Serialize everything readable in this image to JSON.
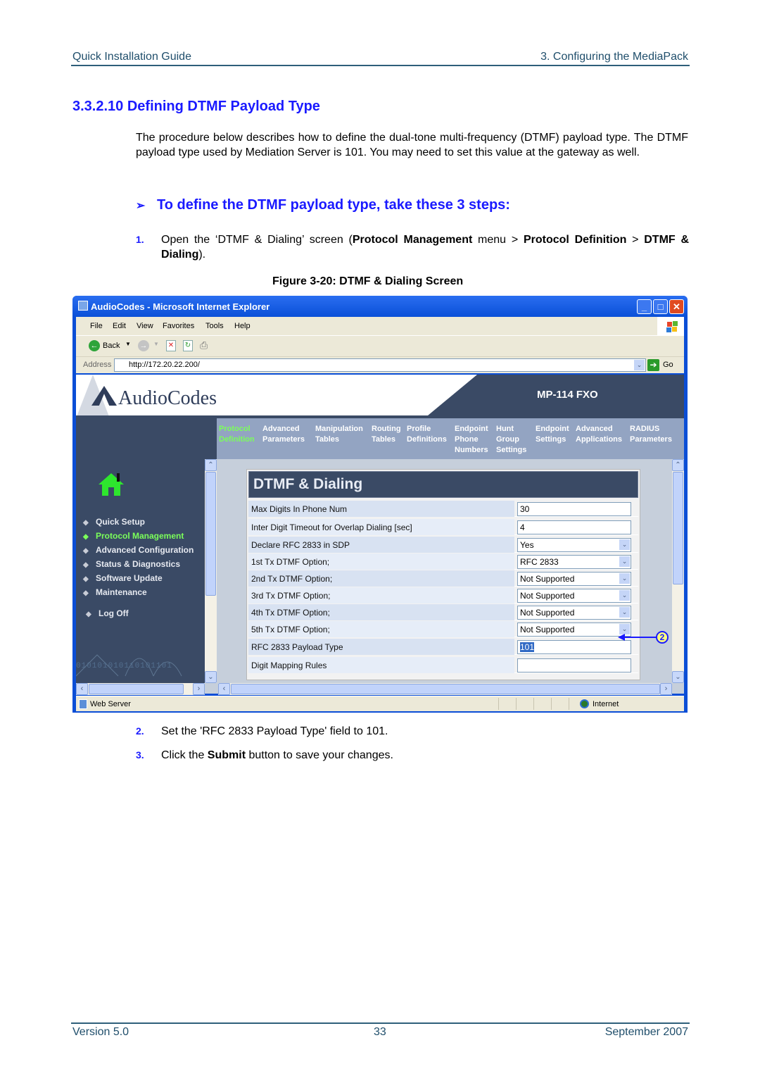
{
  "header": {
    "left": "Quick Installation Guide",
    "right": "3. Configuring the MediaPack"
  },
  "section_title": "3.3.2.10 Defining DTMF Payload Type",
  "intro": "The procedure below describes how to define the dual-tone multi-frequency (DTMF) payload type. The DTMF payload type used by Mediation Server is 101. You may need to set this value at the gateway as well.",
  "procedure_heading": "To define the DTMF payload type, take these 3 steps:",
  "procedure_arrow": "➢",
  "steps": [
    {
      "num": "1.",
      "parts": [
        "Open the ‘DTMF & Dialing’ screen (",
        "Protocol Management",
        " menu > ",
        "Protocol Definition",
        " > ",
        "DTMF & Dialing",
        ")."
      ]
    },
    {
      "num": "2.",
      "text": "Set the 'RFC 2833 Payload Type' field to 101."
    },
    {
      "num": "3.",
      "parts": [
        "Click the ",
        "Submit",
        " button to save your changes."
      ]
    }
  ],
  "figure_caption": "Figure 3-20: DTMF & Dialing Screen",
  "browser": {
    "title": "AudioCodes - Microsoft Internet Explorer",
    "menu": [
      "File",
      "Edit",
      "View",
      "Favorites",
      "Tools",
      "Help"
    ],
    "back_label": "Back",
    "address_label": "Address",
    "address": "http://172.20.22.200/",
    "go_label": "Go",
    "status_left": "Web Server",
    "status_right": "Internet"
  },
  "app": {
    "brand": "AudioCodes",
    "model": "MP-114 FXO",
    "nav": [
      {
        "line1": "Protocol",
        "line2": "Definition",
        "line3": "",
        "active": true
      },
      {
        "line1": "Advanced",
        "line2": "Parameters",
        "line3": ""
      },
      {
        "line1": "Manipulation",
        "line2": "Tables",
        "line3": ""
      },
      {
        "line1": "Routing",
        "line2": "Tables",
        "line3": ""
      },
      {
        "line1": "Profile",
        "line2": "Definitions",
        "line3": ""
      },
      {
        "line1": "Endpoint",
        "line2": "Phone",
        "line3": "Numbers"
      },
      {
        "line1": "Hunt",
        "line2": "Group",
        "line3": "Settings"
      },
      {
        "line1": "Endpoint",
        "line2": "Settings",
        "line3": ""
      },
      {
        "line1": "Advanced",
        "line2": "Applications",
        "line3": ""
      },
      {
        "line1": "RADIUS",
        "line2": "Parameters",
        "line3": ""
      }
    ],
    "sidebar": [
      {
        "label": "Quick Setup"
      },
      {
        "label": "Protocol Management",
        "active": true
      },
      {
        "label": "Advanced Configuration"
      },
      {
        "label": "Status & Diagnostics"
      },
      {
        "label": "Software Update"
      },
      {
        "label": "Maintenance"
      }
    ],
    "logoff": "Log Off",
    "binary_deco": "010101010110101101",
    "panel_title": "DTMF & Dialing",
    "fields": [
      {
        "label": "Max Digits In Phone Num",
        "value": "30",
        "type": "text"
      },
      {
        "label": "Inter Digit Timeout for Overlap Dialing [sec]",
        "value": "4",
        "type": "text"
      },
      {
        "label": "Declare RFC 2833 in SDP",
        "value": "Yes",
        "type": "select"
      },
      {
        "label": "1st Tx DTMF Option;",
        "value": "RFC 2833",
        "type": "select"
      },
      {
        "label": "2nd Tx DTMF Option;",
        "value": "Not Supported",
        "type": "select"
      },
      {
        "label": "3rd Tx DTMF Option;",
        "value": "Not Supported",
        "type": "select"
      },
      {
        "label": "4th Tx DTMF Option;",
        "value": "Not Supported",
        "type": "select"
      },
      {
        "label": "5th Tx DTMF Option;",
        "value": "Not Supported",
        "type": "select"
      },
      {
        "label": "RFC 2833 Payload Type",
        "value": "101",
        "type": "text",
        "selected": true
      },
      {
        "label": "Digit Mapping Rules",
        "value": "",
        "type": "text"
      }
    ],
    "callout": "2"
  },
  "footer": {
    "left": "Version 5.0",
    "center": "33",
    "right": "September 2007"
  },
  "colors": {
    "heading_blue": "#1a1aff",
    "header_teal": "#1f4e6b",
    "app_dark": "#3a4a65",
    "active_green": "#7bff5a"
  }
}
